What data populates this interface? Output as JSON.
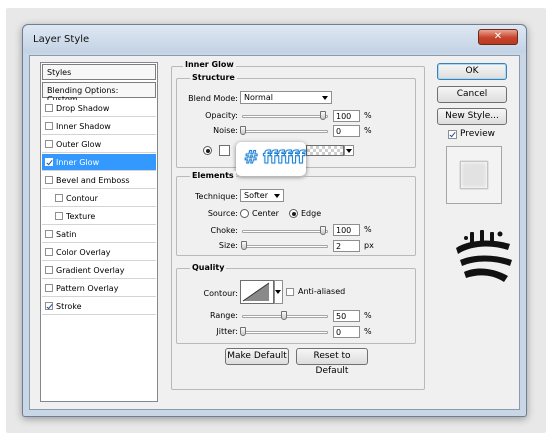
{
  "window": {
    "title": "Layer Style",
    "close_glyph": "✕"
  },
  "styles_list": {
    "header": "Styles",
    "blending_options": "Blending Options: Custom",
    "items": [
      {
        "label": "Drop Shadow",
        "checked": false,
        "selected": false,
        "sub": false
      },
      {
        "label": "Inner Shadow",
        "checked": false,
        "selected": false,
        "sub": false
      },
      {
        "label": "Outer Glow",
        "checked": false,
        "selected": false,
        "sub": false
      },
      {
        "label": "Inner Glow",
        "checked": true,
        "selected": true,
        "sub": false
      },
      {
        "label": "Bevel and Emboss",
        "checked": false,
        "selected": false,
        "sub": false
      },
      {
        "label": "Contour",
        "checked": false,
        "selected": false,
        "sub": true
      },
      {
        "label": "Texture",
        "checked": false,
        "selected": false,
        "sub": true
      },
      {
        "label": "Satin",
        "checked": false,
        "selected": false,
        "sub": false
      },
      {
        "label": "Color Overlay",
        "checked": false,
        "selected": false,
        "sub": false
      },
      {
        "label": "Gradient Overlay",
        "checked": false,
        "selected": false,
        "sub": false
      },
      {
        "label": "Pattern Overlay",
        "checked": false,
        "selected": false,
        "sub": false
      },
      {
        "label": "Stroke",
        "checked": true,
        "selected": false,
        "sub": false
      }
    ]
  },
  "inner_glow": {
    "title": "Inner Glow",
    "structure": {
      "title": "Structure",
      "blend_mode_label": "Blend Mode:",
      "blend_mode_value": "Normal",
      "opacity_label": "Opacity:",
      "opacity_value": "100",
      "opacity_fraction": 1.0,
      "noise_label": "Noise:",
      "noise_value": "0",
      "noise_fraction": 0.0,
      "unit": "%",
      "glow_color": "#ffffff"
    },
    "elements": {
      "title": "Elements",
      "technique_label": "Technique:",
      "technique_value": "Softer",
      "source_label": "Source:",
      "source_center": "Center",
      "source_edge": "Edge",
      "choke_label": "Choke:",
      "choke_value": "100",
      "choke_fraction": 1.0,
      "choke_unit": "%",
      "size_label": "Size:",
      "size_value": "2",
      "size_fraction": 0.01,
      "size_unit": "px"
    },
    "quality": {
      "title": "Quality",
      "contour_label": "Contour:",
      "anti_aliased_label": "Anti-aliased",
      "range_label": "Range:",
      "range_value": "50",
      "range_fraction": 0.5,
      "jitter_label": "Jitter:",
      "jitter_value": "0",
      "jitter_fraction": 0.0,
      "unit": "%"
    },
    "make_default": "Make Default",
    "reset_default": "Reset to Default"
  },
  "color_tooltip": "# ffffff",
  "buttons": {
    "ok": "OK",
    "cancel": "Cancel",
    "new_style": "New Style...",
    "preview_label": "Preview"
  },
  "icons": {
    "watermark_logo": "brand-calligraphy-logo-icon"
  }
}
